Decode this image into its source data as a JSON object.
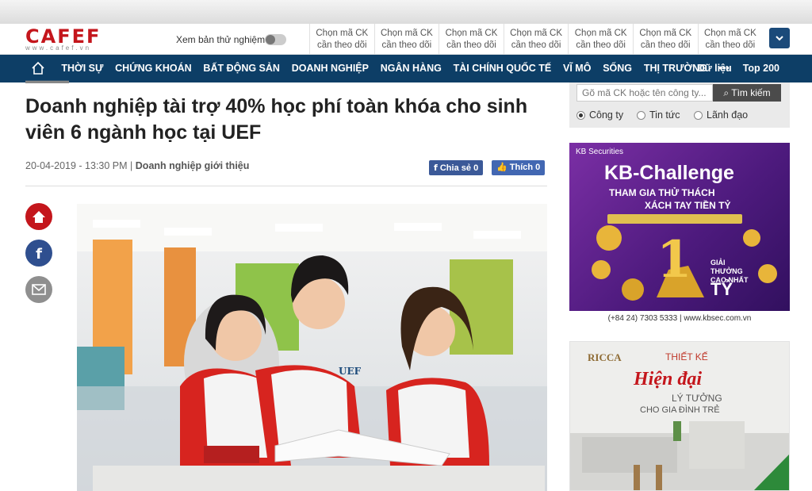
{
  "header": {
    "logo_text": "CAFEF",
    "logo_sub": "www.cafef.vn",
    "trial_label": "Xem bản thử nghiệm",
    "stock_slots": [
      {
        "line1": "Chọn mã CK",
        "line2": "cần theo dõi"
      },
      {
        "line1": "Chọn mã CK",
        "line2": "cần theo dõi"
      },
      {
        "line1": "Chọn mã CK",
        "line2": "cần theo dõi"
      },
      {
        "line1": "Chọn mã CK",
        "line2": "cần theo dõi"
      },
      {
        "line1": "Chọn mã CK",
        "line2": "cần theo dõi"
      },
      {
        "line1": "Chọn mã CK",
        "line2": "cần theo dõi"
      },
      {
        "line1": "Chọn mã CK",
        "line2": "cần theo dõi"
      }
    ]
  },
  "nav": {
    "items": [
      "THỜI SỰ",
      "CHỨNG KHOÁN",
      "BẤT ĐỘNG SẢN",
      "DOANH NGHIỆP",
      "NGÂN HÀNG",
      "TÀI CHÍNH QUỐC TẾ",
      "VĨ MÔ",
      "SỐNG",
      "THỊ TRƯỜNG"
    ],
    "more": "•••",
    "right_items": [
      "Dữ liệu",
      "Top 200"
    ]
  },
  "article": {
    "title": "Doanh nghiệp tài trợ 40% học phí toàn khóa cho sinh viên 6 ngành học tại UEF",
    "date": "20-04-2019 - 13:30 PM",
    "separator": "|",
    "category": "Doanh nghiệp giới thiệu",
    "share_label": "Chia sẻ",
    "share_count": "0",
    "like_label": "Thích",
    "like_count": "0"
  },
  "sidebar": {
    "search_placeholder": "Gõ mã CK hoặc tên công ty...",
    "search_button": "Tìm kiếm",
    "radios": [
      {
        "label": "Công ty",
        "checked": true
      },
      {
        "label": "Tin tức",
        "checked": false
      },
      {
        "label": "Lãnh đạo",
        "checked": false
      }
    ],
    "ad1": {
      "brand": "KB Securities",
      "headline": "KB-Challenge",
      "line1": "THAM GIA THỬ THÁCH",
      "line2": "XÁCH TAY TIỀN TỶ",
      "prize_label": "GIẢI THƯỞNG CAO NHẤT",
      "prize_value": "TỶ",
      "big_number": "1",
      "contact": "(+84 24) 7303 5333 | www.kbsec.com.vn"
    },
    "ad2": {
      "brand": "RICCA",
      "line1": "THIẾT KẾ",
      "line2": "Hiện đại",
      "line3": "LÝ TƯỞNG",
      "line4": "CHO GIA ĐÌNH TRẺ"
    }
  },
  "colors": {
    "brand_red": "#c4161c",
    "nav_blue": "#0d3e66",
    "fb_blue": "#3b5998"
  }
}
